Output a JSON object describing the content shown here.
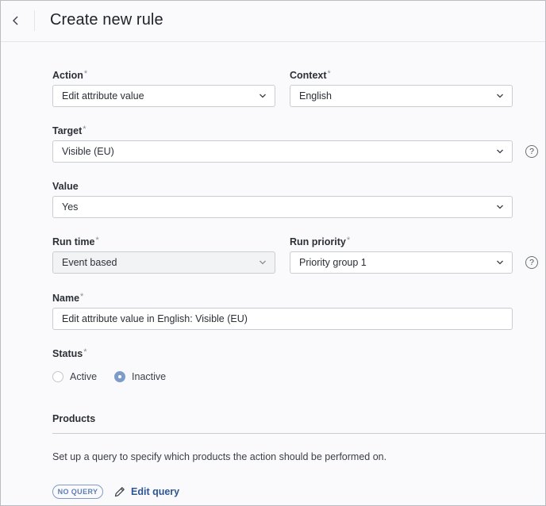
{
  "header": {
    "title": "Create new rule",
    "back_icon": "chevron-left-icon"
  },
  "form": {
    "required_mark": "*",
    "action": {
      "label": "Action",
      "value": "Edit attribute value"
    },
    "context": {
      "label": "Context",
      "value": "English"
    },
    "target": {
      "label": "Target",
      "value": "Visible (EU)",
      "help": "?"
    },
    "value": {
      "label": "Value",
      "value": "Yes"
    },
    "run_time": {
      "label": "Run time",
      "value": "Event based",
      "disabled": true
    },
    "run_priority": {
      "label": "Run priority",
      "value": "Priority group 1",
      "help": "?"
    },
    "name": {
      "label": "Name",
      "value": "Edit attribute value in English: Visible (EU)"
    },
    "status": {
      "label": "Status",
      "options": [
        {
          "label": "Active",
          "checked": false
        },
        {
          "label": "Inactive",
          "checked": true
        }
      ]
    }
  },
  "products": {
    "title": "Products",
    "description": "Set up a query to specify which products the action should be performed on.",
    "badge": "NO QUERY",
    "edit_query_label": "Edit query",
    "edit_icon": "pencil-icon"
  },
  "colors": {
    "accent": "#7e9cc9",
    "link": "#2e5596",
    "border": "#c9ccd2"
  }
}
